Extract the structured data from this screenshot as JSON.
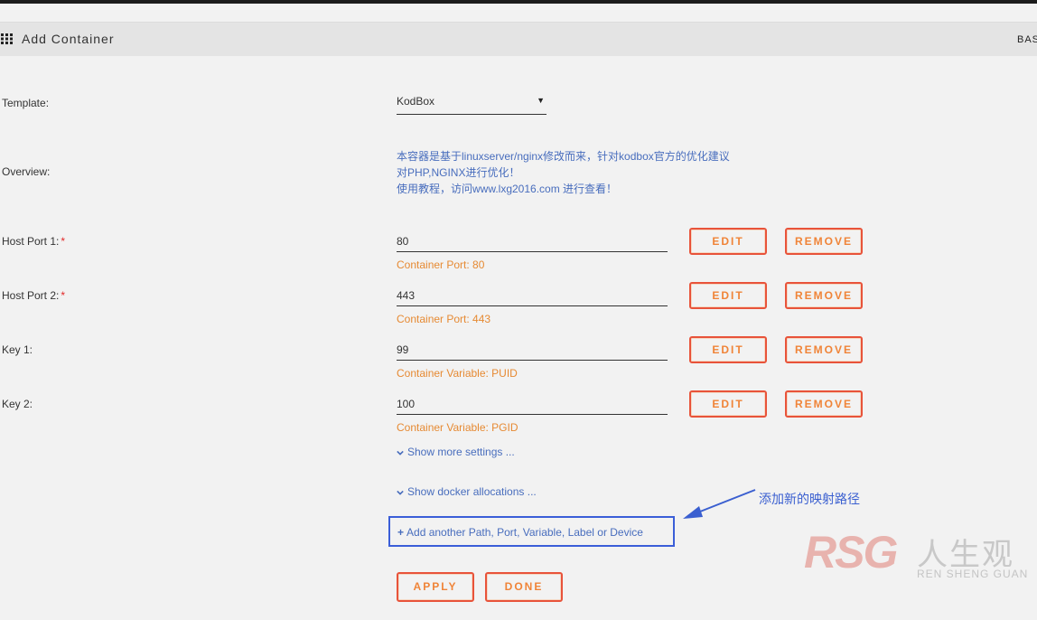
{
  "header": {
    "title": "Add Container",
    "mode": "BAS"
  },
  "form": {
    "template_label": "Template:",
    "template_value": "KodBox",
    "overview_label": "Overview:",
    "overview_lines": [
      "本容器是基于linuxserver/nginx修改而来，针对kodbox官方的优化建议",
      "对PHP,NGINX进行优化！",
      "使用教程，访问www.lxg2016.com 进行查看！"
    ],
    "rows": [
      {
        "label": "Host Port 1:",
        "required": "*",
        "value": "80",
        "hint": "Container Port: 80"
      },
      {
        "label": "Host Port 2:",
        "required": "*",
        "value": "443",
        "hint": "Container Port: 443"
      },
      {
        "label": "Key 1:",
        "required": "",
        "value": "99",
        "hint": "Container Variable: PUID"
      },
      {
        "label": "Key 2:",
        "required": "",
        "value": "100",
        "hint": "Container Variable: PGID"
      }
    ],
    "edit_label": "EDIT",
    "remove_label": "REMOVE",
    "show_more": "Show more settings ...",
    "show_docker": "Show docker allocations ...",
    "add_another": "Add another Path, Port, Variable, Label or Device",
    "apply_label": "APPLY",
    "done_label": "DONE"
  },
  "annotation": {
    "text": "添加新的映射路径",
    "color": "#3a5fd0"
  },
  "watermark": {
    "logo": "RSG",
    "cn": "人生观",
    "sub": "REN SHENG GUAN"
  },
  "colors": {
    "accent_orange": "#f08438",
    "button_border": "#e8533a",
    "link_blue": "#486dbd",
    "highlight_box": "#3b5ed8"
  }
}
